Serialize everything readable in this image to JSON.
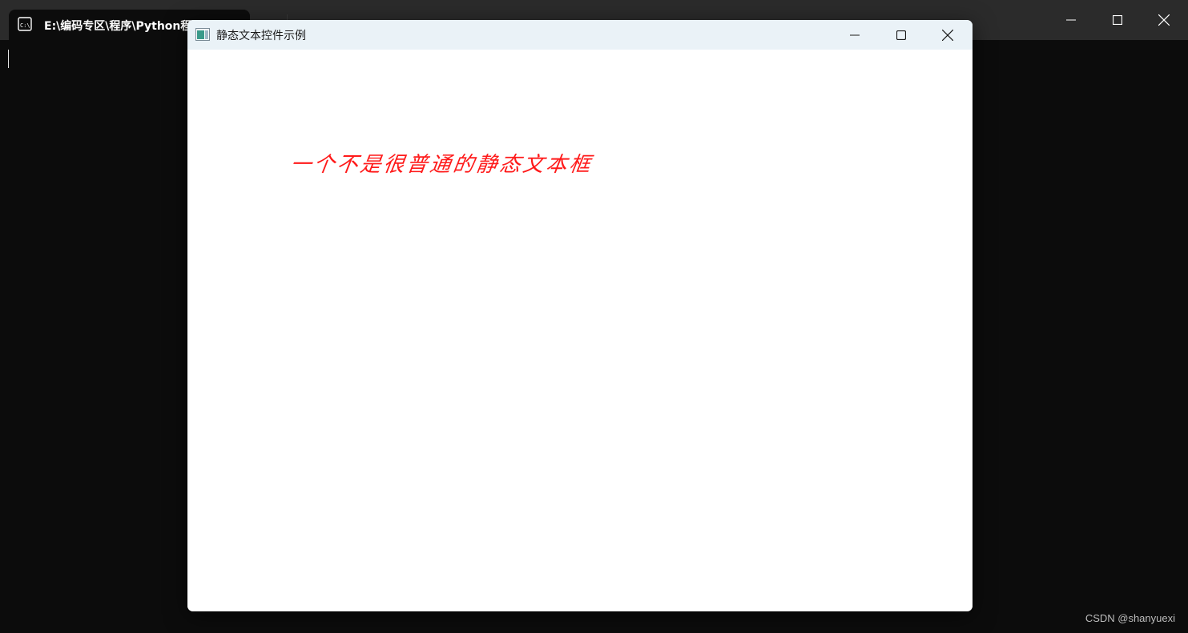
{
  "terminal": {
    "tab_title": "E:\\编码专区\\程序\\Python程"
  },
  "dialog": {
    "title": "静态文本控件示例",
    "static_text": "一个不是很普通的静态文本框",
    "static_text_color": "#ff1a1a"
  },
  "watermark": "CSDN @shanyuexi",
  "icons": {
    "terminal_tab": "terminal-icon",
    "dialog_app": "app-window-icon",
    "minimize": "minimize-icon",
    "maximize": "maximize-icon",
    "close": "close-icon"
  }
}
